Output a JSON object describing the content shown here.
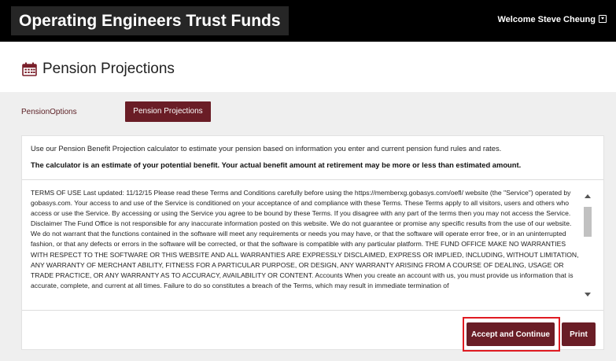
{
  "header": {
    "brand": "Operating Engineers Trust Funds",
    "welcome": "Welcome Steve Cheung"
  },
  "page": {
    "title": "Pension Projections",
    "icon": "calendar-icon"
  },
  "tabs": [
    {
      "label": "PensionOptions",
      "active": false
    },
    {
      "label": "Pension Projections",
      "active": true
    }
  ],
  "content": {
    "intro": "Use our Pension Benefit Projection calculator to estimate your pension based on information you enter and current pension fund rules and rates.",
    "intro_bold": "The calculator is an estimate of your potential benefit. Your actual benefit amount at retirement may be more or less than estimated amount.",
    "terms": "TERMS OF USE Last updated: 11/12/15 Please read these Terms and Conditions carefully before using the https://memberxg.gobasys.com/oefl/ website (the \"Service\") operated by gobasys.com. Your access to and use of the Service is conditioned on your acceptance of and compliance with these Terms. These Terms apply to all visitors, users and others who access or use the Service. By accessing or using the Service you agree to be bound by these Terms. If you disagree with any part of the terms then you may not access the Service. Disclaimer The Fund Office is not responsible for any inaccurate information posted on this website. We do not guarantee or promise any specific results from the use of our website. We do not warrant that the functions contained in the software will meet any requirements or needs you may have, or that the software will operate error free, or in an uninterrupted fashion, or that any defects or errors in the software will be corrected, or that the software is compatible with any particular platform. THE FUND OFFICE MAKE NO WARRANTIES WITH RESPECT TO THE SOFTWARE OR THIS WEBSITE AND ALL WARRANTIES ARE EXPRESSLY DISCLAIMED, EXPRESS OR IMPLIED, INCLUDING, WITHOUT LIMITATION, ANY WARRANTY OF MERCHANT ABILITY, FITNESS FOR A PARTICULAR PURPOSE, OR DESIGN, ANY WARRANTY ARISING FROM A COURSE OF DEALING, USAGE OR TRADE PRACTICE, OR ANY WARRANTY AS TO ACCURACY, AVAILABILITY OR CONTENT. Accounts When you create an account with us, you must provide us information that is accurate, complete, and current at all times. Failure to do so constitutes a breach of the Terms, which may result in immediate termination of"
  },
  "actions": {
    "accept_label": "Accept and Continue",
    "print_label": "Print"
  },
  "colors": {
    "accent": "#6a1d26",
    "highlight": "#e01b22",
    "header_bg": "#000000"
  }
}
